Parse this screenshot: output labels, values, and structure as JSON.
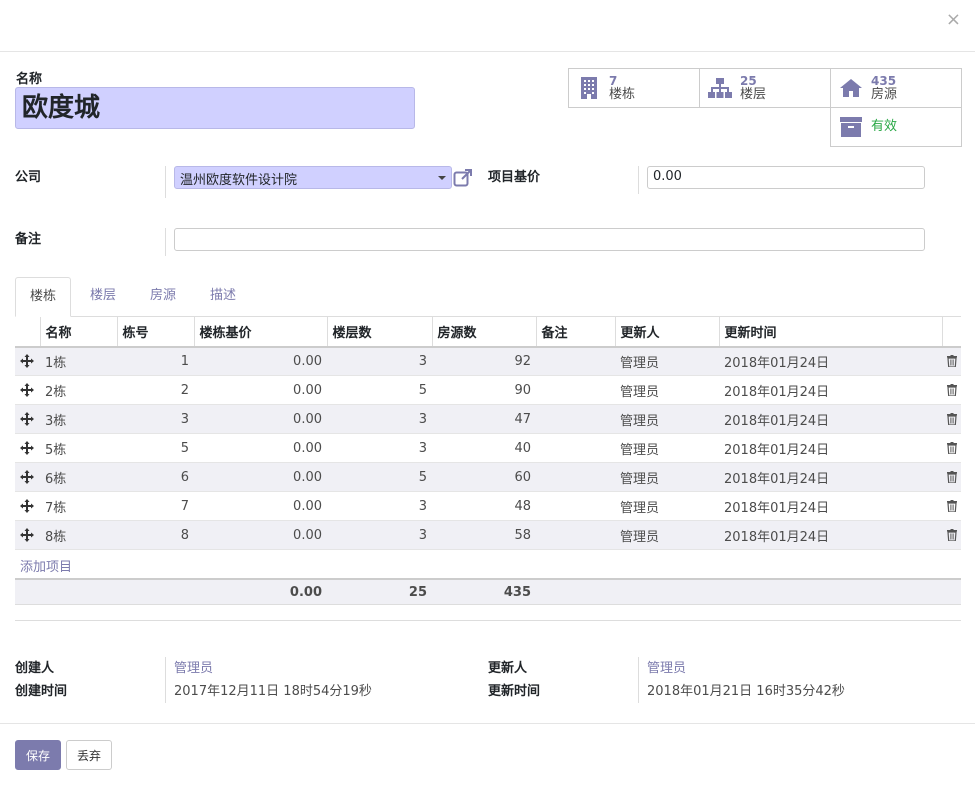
{
  "header": {
    "close_label": "×"
  },
  "form": {
    "name_label": "名称",
    "name_value": "欧度城",
    "company_label": "公司",
    "company_value": "温州欧度软件设计院",
    "base_price_label": "项目基价",
    "base_price_value": "0.00",
    "note_label": "备注",
    "note_value": ""
  },
  "stats": [
    {
      "count": "7",
      "label": "楼栋",
      "icon": "building-icon"
    },
    {
      "count": "25",
      "label": "楼层",
      "icon": "sitemap-icon"
    },
    {
      "count": "435",
      "label": "房源",
      "icon": "home-icon"
    },
    {
      "count": "",
      "label": "有效",
      "icon": "archive-icon"
    }
  ],
  "tabs": [
    {
      "label": "楼栋",
      "active": true
    },
    {
      "label": "楼层",
      "active": false
    },
    {
      "label": "房源",
      "active": false
    },
    {
      "label": "描述",
      "active": false
    }
  ],
  "table": {
    "columns": [
      "名称",
      "栋号",
      "楼栋基价",
      "楼层数",
      "房源数",
      "备注",
      "更新人",
      "更新时间"
    ],
    "rows": [
      {
        "name": "1栋",
        "no": "1",
        "price": "0.00",
        "floors": "3",
        "rooms": "92",
        "note": "",
        "updater": "管理员",
        "updated": "2018年01月24日"
      },
      {
        "name": "2栋",
        "no": "2",
        "price": "0.00",
        "floors": "5",
        "rooms": "90",
        "note": "",
        "updater": "管理员",
        "updated": "2018年01月24日"
      },
      {
        "name": "3栋",
        "no": "3",
        "price": "0.00",
        "floors": "3",
        "rooms": "47",
        "note": "",
        "updater": "管理员",
        "updated": "2018年01月24日"
      },
      {
        "name": "5栋",
        "no": "5",
        "price": "0.00",
        "floors": "3",
        "rooms": "40",
        "note": "",
        "updater": "管理员",
        "updated": "2018年01月24日"
      },
      {
        "name": "6栋",
        "no": "6",
        "price": "0.00",
        "floors": "5",
        "rooms": "60",
        "note": "",
        "updater": "管理员",
        "updated": "2018年01月24日"
      },
      {
        "name": "7栋",
        "no": "7",
        "price": "0.00",
        "floors": "3",
        "rooms": "48",
        "note": "",
        "updater": "管理员",
        "updated": "2018年01月24日"
      },
      {
        "name": "8栋",
        "no": "8",
        "price": "0.00",
        "floors": "3",
        "rooms": "58",
        "note": "",
        "updater": "管理员",
        "updated": "2018年01月24日"
      }
    ],
    "add_line": "添加项目",
    "totals": {
      "price": "0.00",
      "floors": "25",
      "rooms": "435"
    }
  },
  "meta": {
    "created_by_label": "创建人",
    "created_by": "管理员",
    "created_at_label": "创建时间",
    "created_at": "2017年12月11日 18时54分19秒",
    "updated_by_label": "更新人",
    "updated_by": "管理员",
    "updated_at_label": "更新时间",
    "updated_at": "2018年01月21日 16时35分42秒"
  },
  "buttons": {
    "save": "保存",
    "discard": "丢弃"
  },
  "colors": {
    "primary": "#7c7bad",
    "required_field": "#d0d0ff",
    "active_green": "#28a745"
  }
}
